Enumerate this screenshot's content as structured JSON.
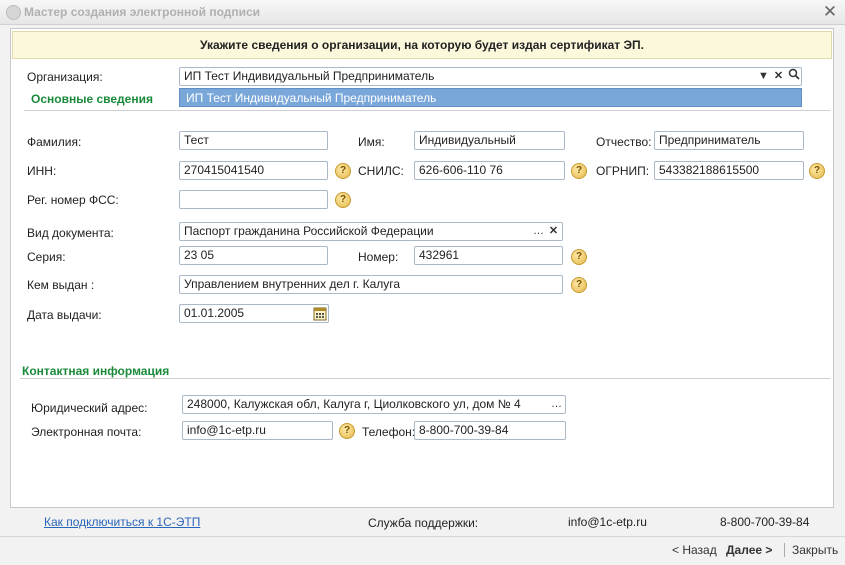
{
  "window": {
    "title": "Мастер создания электронной подписи",
    "close_glyph": "✕"
  },
  "banner": "Укажите сведения о организации, на которую будет издан сертификат ЭП.",
  "org": {
    "label": "Организация:",
    "value": "ИП Тест Индивидуальный Предприниматель",
    "dropdown_item": "ИП Тест Индивидуальный Предприниматель"
  },
  "sections": {
    "basic": "Основные сведения",
    "contact": "Контактная информация"
  },
  "fields": {
    "surname_label": "Фамилия:",
    "surname": "Тест",
    "name_label": "Имя:",
    "name": "Индивидуальный",
    "patronymic_label": "Отчество:",
    "patronymic": "Предприниматель",
    "inn_label": "ИНН:",
    "inn": "270415041540",
    "snils_label": "СНИЛС:",
    "snils": "626-606-110 76",
    "ogrnip_label": "ОГРНИП:",
    "ogrnip": "543382188615500",
    "fss_label": "Рег. номер ФСС:",
    "fss": "",
    "doctype_label": "Вид документа:",
    "doctype": "Паспорт гражданина Российской Федерации",
    "series_label": "Серия:",
    "series": "23 05",
    "number_label": "Номер:",
    "number": "432961",
    "issuer_label": "Кем выдан :",
    "issuer": "Управлением внутренних дел г. Калуга",
    "issue_date_label": "Дата выдачи:",
    "issue_date": "01.01.2005"
  },
  "contact": {
    "address_label": "Юридический адрес:",
    "address": "248000, Калужская обл, Калуга г, Циолковского ул, дом № 4",
    "email_label": "Электронная почта:",
    "email": "info@1c-etp.ru",
    "phone_label": "Телефон:",
    "phone": "8-800-700-39-84"
  },
  "footer": {
    "link": "Как подключиться к 1С-ЭТП",
    "support_label": "Служба поддержки:",
    "support_email": "info@1c-etp.ru",
    "support_phone": "8-800-700-39-84"
  },
  "nav": {
    "back": "< Назад",
    "next": "Далее >",
    "close": "Закрыть"
  },
  "icons": {
    "help": "question-icon",
    "dropdown": "chevron-down-icon",
    "clear": "clear-icon",
    "search": "search-icon",
    "calendar": "calendar-icon",
    "ellipsis": "ellipsis-icon"
  },
  "colors": {
    "section_green": "#1a8a3a",
    "banner_bg": "#fbf8dc",
    "selection_blue": "#7aa7d9",
    "link_blue": "#2a66b8"
  }
}
